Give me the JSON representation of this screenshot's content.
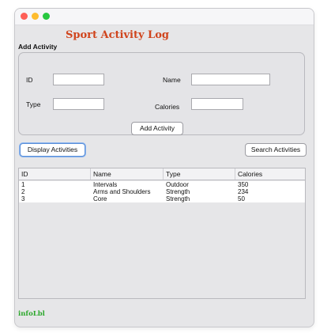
{
  "window": {
    "title": "Sport Activity Log"
  },
  "form": {
    "section_label": "Add Activity",
    "id_label": "ID",
    "id_value": "",
    "name_label": "Name",
    "name_value": "",
    "type_label": "Type",
    "type_value": "",
    "calories_label": "Calories",
    "calories_value": "",
    "add_button": "Add Activity"
  },
  "actions": {
    "display_button": "Display Activities",
    "search_button": "Search Activities"
  },
  "table": {
    "columns": [
      "ID",
      "Name",
      "Type",
      "Calories"
    ],
    "rows": [
      [
        "1",
        "Intervals",
        "Outdoor",
        "350"
      ],
      [
        "2",
        "Arms and Shoulders",
        "Strength",
        "234"
      ],
      [
        "3",
        "Core",
        "Strength",
        "50"
      ]
    ]
  },
  "status": {
    "info_label": "infoLbl"
  },
  "colors": {
    "title": "#d0441c",
    "info": "#2da82d",
    "focus_ring": "#5b8fd8"
  }
}
